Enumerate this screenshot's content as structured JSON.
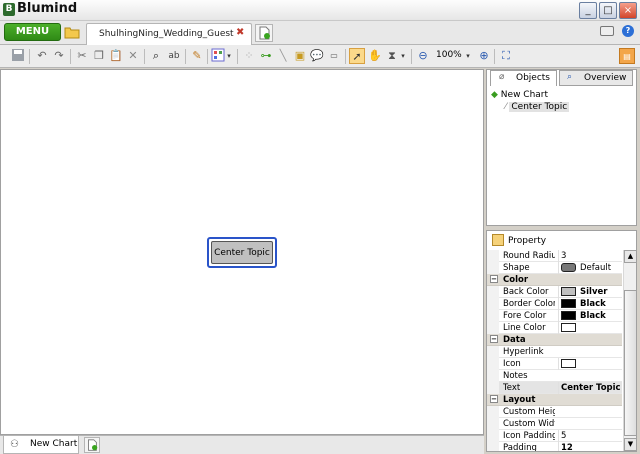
{
  "app": {
    "title": "Blumind",
    "logo_glyph": "B"
  },
  "window_buttons": {
    "minimize": "_",
    "maximize": "□",
    "close": "×"
  },
  "tabstrip": {
    "menu_label": "MENU",
    "document_tab": "ShulhingNing_Wedding_Guest",
    "close_glyph": "✖",
    "help_glyph": "?"
  },
  "toolbar": {
    "zoom_level": "100%",
    "icons": [
      "save-icon",
      "undo-icon",
      "redo-icon",
      "cut-icon",
      "copy-icon",
      "paste-icon",
      "delete-icon",
      "find-icon",
      "replace-icon",
      "format-painter-icon",
      "layout-icon",
      "add-topic-icon",
      "link-icon",
      "line-icon",
      "note-icon",
      "callout-icon",
      "label-icon",
      "select-icon",
      "hand-icon",
      "timer-icon",
      "zoom-out-icon",
      "zoom-in-icon",
      "fit-icon",
      "panel-toggle-icon"
    ]
  },
  "canvas": {
    "center_topic": "Center Topic"
  },
  "bottom_tabs": {
    "chart_tab": "New Chart"
  },
  "objects_panel": {
    "tabs": {
      "objects": "Objects",
      "overview": "Overview"
    },
    "tree": {
      "root": "New Chart",
      "child": "Center Topic"
    }
  },
  "property_panel": {
    "title": "Property",
    "rows": [
      {
        "type": "prop",
        "name": "Round Radius",
        "value": "3"
      },
      {
        "type": "prop",
        "name": "Shape",
        "value": "Default",
        "swatch": "shape"
      },
      {
        "type": "cat",
        "name": "Color"
      },
      {
        "type": "prop",
        "name": "Back Color",
        "value": "Silver",
        "swatch": "#c0c0c0",
        "bold": true
      },
      {
        "type": "prop",
        "name": "Border Color",
        "value": "Black",
        "swatch": "#000000",
        "bold": true
      },
      {
        "type": "prop",
        "name": "Fore Color",
        "value": "Black",
        "swatch": "#000000",
        "bold": true
      },
      {
        "type": "prop",
        "name": "Line Color",
        "value": "",
        "swatch": "#ffffff"
      },
      {
        "type": "cat",
        "name": "Data"
      },
      {
        "type": "prop",
        "name": "Hyperlink",
        "value": ""
      },
      {
        "type": "prop",
        "name": "Icon",
        "value": "",
        "swatch": "#ffffff"
      },
      {
        "type": "prop",
        "name": "Notes",
        "value": ""
      },
      {
        "type": "prop",
        "name": "Text",
        "value": "Center Topic",
        "bold": true,
        "selected": true
      },
      {
        "type": "cat",
        "name": "Layout"
      },
      {
        "type": "prop",
        "name": "Custom Height",
        "value": ""
      },
      {
        "type": "prop",
        "name": "Custom Width",
        "value": ""
      },
      {
        "type": "prop",
        "name": "Icon Padding",
        "value": "5"
      },
      {
        "type": "prop",
        "name": "Padding",
        "value": "12",
        "bold": true
      }
    ]
  },
  "colors": {
    "accent": "#2a54c9",
    "menu_green": "#3a9c20",
    "topic_fill": "#c0c0c0"
  }
}
